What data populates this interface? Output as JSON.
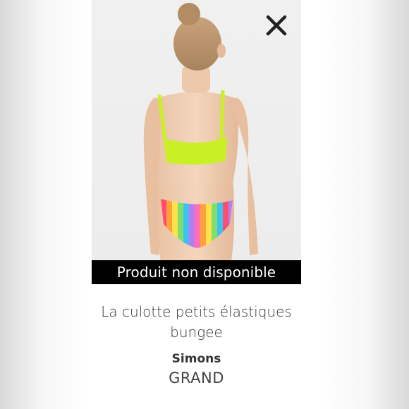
{
  "overlay": {
    "banner_text": "Produit non disponible"
  },
  "product": {
    "name": "La culotte petits élastiques bungee",
    "brand": "Simons",
    "size": "GRAND"
  },
  "icons": {
    "close": "close-icon"
  },
  "colors": {
    "banner_bg": "#000000",
    "banner_text": "#ffffff",
    "text": "#333333",
    "top_color": "#c8f025"
  }
}
